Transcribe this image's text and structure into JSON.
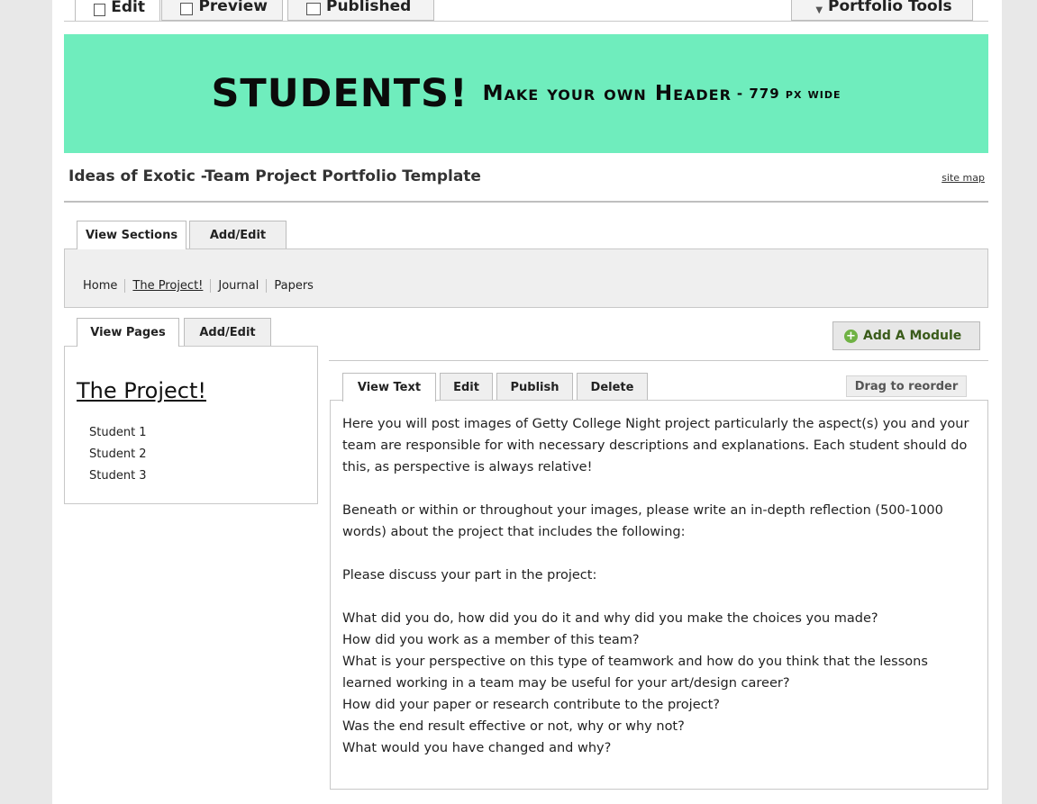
{
  "mode_tabs": [
    {
      "label": "Edit"
    },
    {
      "label": "Preview"
    },
    {
      "label": "Published"
    },
    {
      "label": "Portfolio Tools"
    }
  ],
  "banner": {
    "big": "STUDENTS!",
    "mid": "Make your own Header",
    "small": "- 779 px wide",
    "background": "#6fedbd"
  },
  "header": {
    "title": "Ideas of Exotic -Team Project Portfolio Template",
    "site_map": "site map"
  },
  "section_tabs": {
    "view": "View Sections",
    "add_edit": "Add/Edit",
    "links": [
      "Home",
      "The Project!",
      "Journal",
      "Papers"
    ],
    "current": "The Project!"
  },
  "page_tabs": {
    "view": "View Pages",
    "add_edit": "Add/Edit",
    "page_title": "The Project!",
    "pages": [
      "Student 1",
      "Student 2",
      "Student 3"
    ]
  },
  "module": {
    "add_label": "Add A Module",
    "tabs": [
      "View Text",
      "Edit",
      "Publish",
      "Delete"
    ],
    "drag_label": "Drag to reorder",
    "paragraphs": [
      "Here you will post images of Getty College Night project particularly the aspect(s) you and your team are responsible for with necessary descriptions and explanations.  Each student should do this, as perspective is always relative!",
      "Beneath or within or throughout your images, please write an in-depth reflection (500-1000 words) about the project that includes the following:",
      "Please discuss your part in the project:"
    ],
    "questions": [
      "What did you do, how did you do it and why did you make the choices you made?",
      "How did you work as a member of this team?",
      "What is your perspective on this type of teamwork and how do you think that the lessons learned working in a team may be useful for your art/design career?",
      "How did your paper or research contribute to the project?",
      "Was the end result effective or not, why or why not?",
      "What would you have changed and why?"
    ]
  }
}
